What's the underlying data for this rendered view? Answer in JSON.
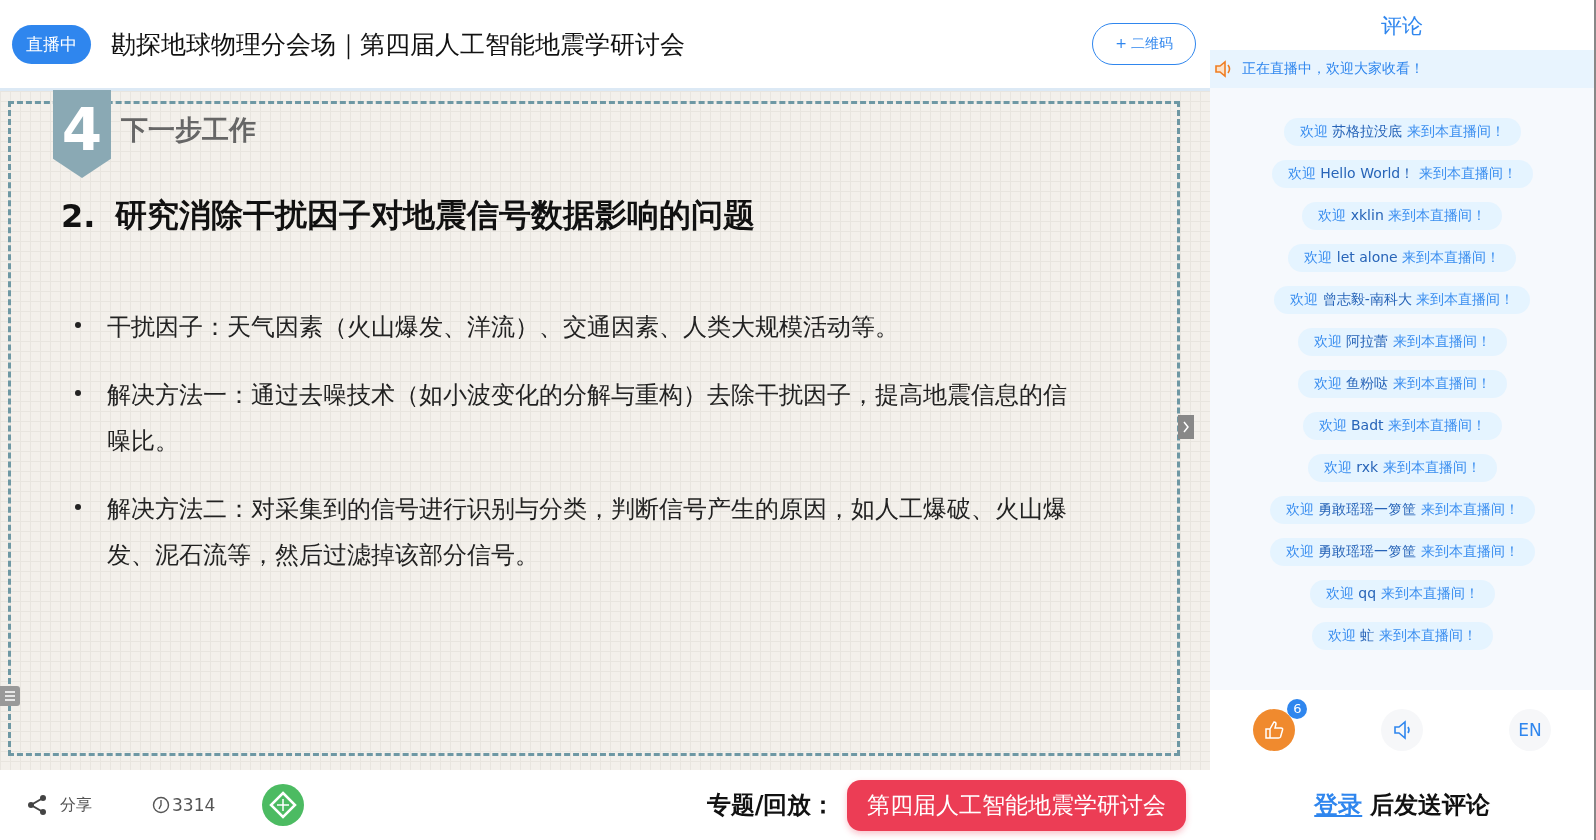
{
  "header": {
    "live_badge": "直播中",
    "title": "勘探地球物理分会场｜第四届人工智能地震学研讨会",
    "qr_button": "+ 二维码"
  },
  "slide": {
    "section_number": "4",
    "section_title": "下一步工作",
    "heading_number": "2.",
    "heading": "研究消除干扰因子对地震信号数据影响的问题",
    "bullets": [
      "干扰因子：天气因素（火山爆发、洋流）、交通因素、人类大规模活动等。",
      "解决方法一：通过去噪技术（如小波变化的分解与重构）去除干扰因子，提高地震信息的信噪比。",
      "解决方法二：对采集到的信号进行识别与分类，判断信号产生的原因，如人工爆破、火山爆发、泥石流等，然后过滤掉该部分信号。"
    ]
  },
  "bottom_bar": {
    "share": "分享",
    "views": "3314",
    "topic_label": "专题/回放：",
    "topic_button": "第四届人工智能地震学研讨会"
  },
  "comments": {
    "title": "评论",
    "notice": "正在直播中，欢迎大家收看！",
    "messages": [
      {
        "prefix": "欢迎",
        "name": "苏格拉没底",
        "suffix": "来到本直播间！"
      },
      {
        "prefix": "欢迎",
        "name": "Hello World！",
        "suffix": "来到本直播间！"
      },
      {
        "prefix": "欢迎",
        "name": "xklin",
        "suffix": "来到本直播间！"
      },
      {
        "prefix": "欢迎",
        "name": "let alone",
        "suffix": "来到本直播间！"
      },
      {
        "prefix": "欢迎",
        "name": "曾志毅-南科大",
        "suffix": "来到本直播间！"
      },
      {
        "prefix": "欢迎",
        "name": "阿拉蕾",
        "suffix": "来到本直播间！"
      },
      {
        "prefix": "欢迎",
        "name": "鱼粉哒",
        "suffix": "来到本直播间！"
      },
      {
        "prefix": "欢迎",
        "name": "Badt",
        "suffix": "来到本直播间！"
      },
      {
        "prefix": "欢迎",
        "name": "rxk",
        "suffix": "来到本直播间！"
      },
      {
        "prefix": "欢迎",
        "name": "勇敢瑶瑶一箩筐",
        "suffix": "来到本直播间！"
      },
      {
        "prefix": "欢迎",
        "name": "勇敢瑶瑶一箩筐",
        "suffix": "来到本直播间！"
      },
      {
        "prefix": "欢迎",
        "name": "qq",
        "suffix": "来到本直播间！"
      },
      {
        "prefix": "欢迎",
        "name": "虻",
        "suffix": "来到本直播间！"
      }
    ],
    "like_count": "6",
    "language": "EN",
    "login_link": "登录",
    "login_suffix": "后发送评论"
  }
}
